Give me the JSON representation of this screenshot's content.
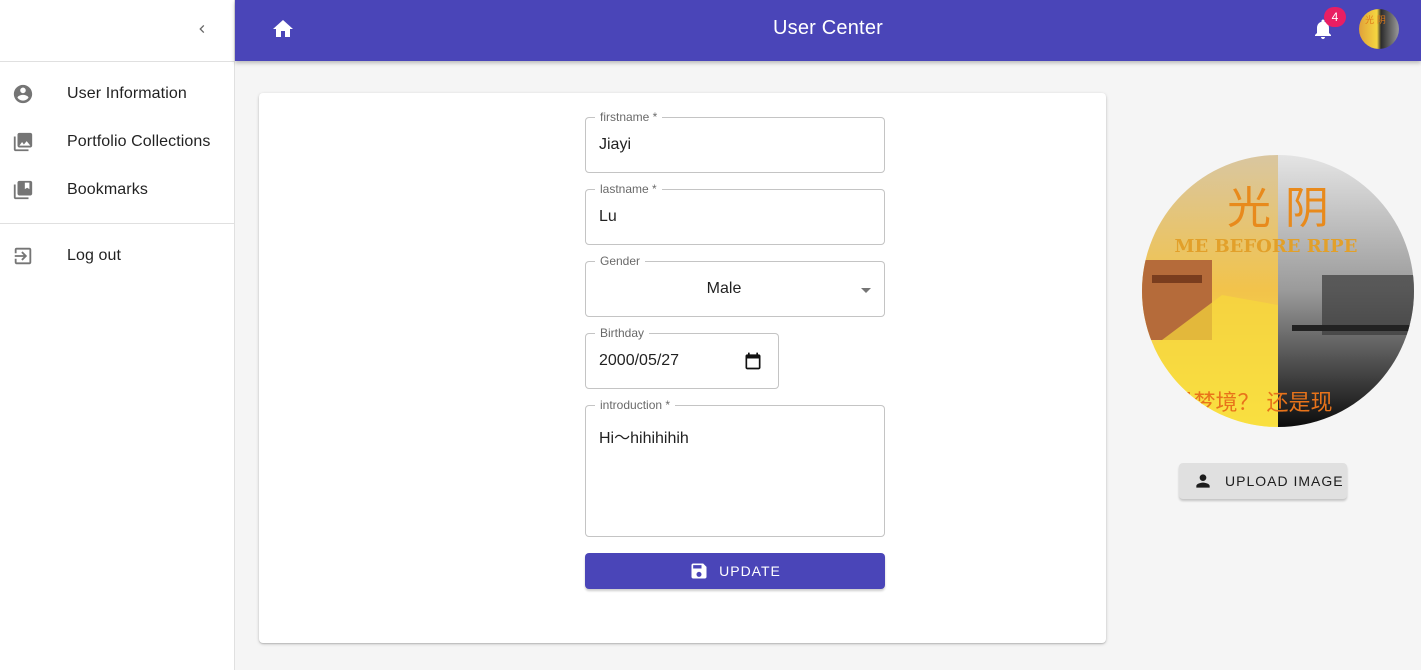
{
  "sidebar": {
    "collapse_icon": "chevron-left-icon",
    "items": [
      {
        "label": "User Information",
        "icon": "account-circle-icon"
      },
      {
        "label": "Portfolio Collections",
        "icon": "photo-library-icon"
      },
      {
        "label": "Bookmarks",
        "icon": "library-books-icon"
      }
    ],
    "logout": {
      "label": "Log out",
      "icon": "logout-icon"
    }
  },
  "appbar": {
    "title": "User Center",
    "notification_count": "4",
    "accent": "#4a45b8"
  },
  "form": {
    "firstname": {
      "label": "firstname *",
      "value": "Jiayi"
    },
    "lastname": {
      "label": "lastname *",
      "value": "Lu"
    },
    "gender": {
      "label": "Gender",
      "value": "Male"
    },
    "birthday": {
      "label": "Birthday",
      "value": "2000/05/27"
    },
    "introduction": {
      "label": "introduction *",
      "value": "Hi～hihihihih"
    },
    "update_label": "UPDATE"
  },
  "avatar_panel": {
    "image_title_cn": "光 阴",
    "image_title_en": "ME BEFORE RIPE",
    "image_caption_cn": "是梦境？ 还是现",
    "upload_label": "UPLOAD IMAGE"
  }
}
